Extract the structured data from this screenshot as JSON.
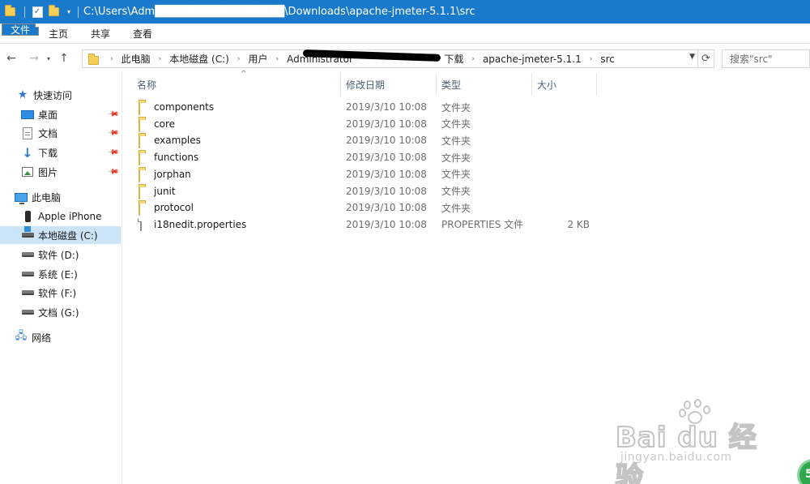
{
  "window": {
    "title_path": "C:\\Users\\Adm████████████████\\Downloads\\apache-jmeter-5.1.1\\src"
  },
  "ribbon": {
    "tabs": [
      "文件",
      "主页",
      "共享",
      "查看"
    ]
  },
  "address": {
    "crumbs": [
      "此电脑",
      "本地磁盘 (C:)",
      "用户",
      "Administrator",
      "下载",
      "apache-jmeter-5.1.1",
      "src"
    ]
  },
  "search": {
    "placeholder": "搜索\"src\""
  },
  "sidebar": {
    "quick_access": "快速访问",
    "pinned": [
      "桌面",
      "文档",
      "下载",
      "图片"
    ],
    "this_pc": "此电脑",
    "devices": [
      "Apple iPhone",
      "本地磁盘 (C:)",
      "软件 (D:)",
      "系统 (E:)",
      "软件 (F:)",
      "文档 (G:)"
    ],
    "network": "网络"
  },
  "columns": {
    "name": "名称",
    "date": "修改日期",
    "type": "类型",
    "size": "大小"
  },
  "files": [
    {
      "name": "components",
      "date": "2019/3/10 10:08",
      "type": "文件夹",
      "size": "",
      "icon": "folder-icon"
    },
    {
      "name": "core",
      "date": "2019/3/10 10:08",
      "type": "文件夹",
      "size": "",
      "icon": "folder-icon"
    },
    {
      "name": "examples",
      "date": "2019/3/10 10:08",
      "type": "文件夹",
      "size": "",
      "icon": "folder-icon"
    },
    {
      "name": "functions",
      "date": "2019/3/10 10:08",
      "type": "文件夹",
      "size": "",
      "icon": "folder-icon"
    },
    {
      "name": "jorphan",
      "date": "2019/3/10 10:08",
      "type": "文件夹",
      "size": "",
      "icon": "folder-icon"
    },
    {
      "name": "junit",
      "date": "2019/3/10 10:08",
      "type": "文件夹",
      "size": "",
      "icon": "folder-icon"
    },
    {
      "name": "protocol",
      "date": "2019/3/10 10:08",
      "type": "文件夹",
      "size": "",
      "icon": "folder-icon"
    },
    {
      "name": "i18nedit.properties",
      "date": "2019/3/10 10:08",
      "type": "PROPERTIES 文件",
      "size": "2 KB",
      "icon": "file-icon"
    }
  ],
  "watermark": {
    "brand": "Bai du 经验",
    "url": "jingyan.baidu.com"
  },
  "colors": {
    "accent": "#1979ca",
    "selection": "#cce4f7",
    "folder": "#f8d775"
  }
}
